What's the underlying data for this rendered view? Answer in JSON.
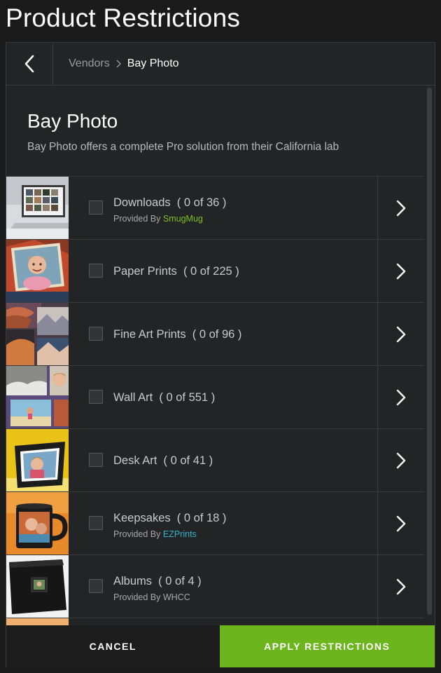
{
  "page": {
    "title": "Product Restrictions"
  },
  "breadcrumb": {
    "parent": "Vendors",
    "current": "Bay Photo"
  },
  "vendor": {
    "name": "Bay Photo",
    "description": "Bay Photo offers a complete Pro solution from their California lab"
  },
  "products": [
    {
      "label": "Downloads  ( 0 of 36 )",
      "provider_prefix": "Provided By ",
      "provider": "SmugMug",
      "provider_color": "#7cc124",
      "thumb": "laptop"
    },
    {
      "label": "Paper Prints  ( 0 of 225 )",
      "provider_prefix": "",
      "provider": "",
      "thumb": "child"
    },
    {
      "label": "Fine Art Prints  ( 0 of 96 )",
      "provider_prefix": "",
      "provider": "",
      "thumb": "canyon"
    },
    {
      "label": "Wall Art  ( 0 of 551 )",
      "provider_prefix": "",
      "provider": "",
      "thumb": "wall"
    },
    {
      "label": "Desk Art  ( 0 of 41 )",
      "provider_prefix": "",
      "provider": "",
      "thumb": "frame"
    },
    {
      "label": "Keepsakes  ( 0 of 18 )",
      "provider_prefix": "Provided By ",
      "provider": "EZPrints",
      "provider_color": "#2eb5c8",
      "thumb": "mug"
    },
    {
      "label": "Albums  ( 0 of 4 )",
      "provider_prefix": "Provided By WHCC",
      "provider": "",
      "thumb": "album"
    }
  ],
  "footer": {
    "cancel_label": "CANCEL",
    "apply_label": "APPLY RESTRICTIONS"
  },
  "colors": {
    "accent": "#6cb51c",
    "background": "#1a1a1a",
    "panel": "#232425"
  },
  "icons": {
    "back": "chevron-left-icon",
    "row": "chevron-right-icon",
    "breadcrumb_separator": "chevron-right-small-icon"
  }
}
